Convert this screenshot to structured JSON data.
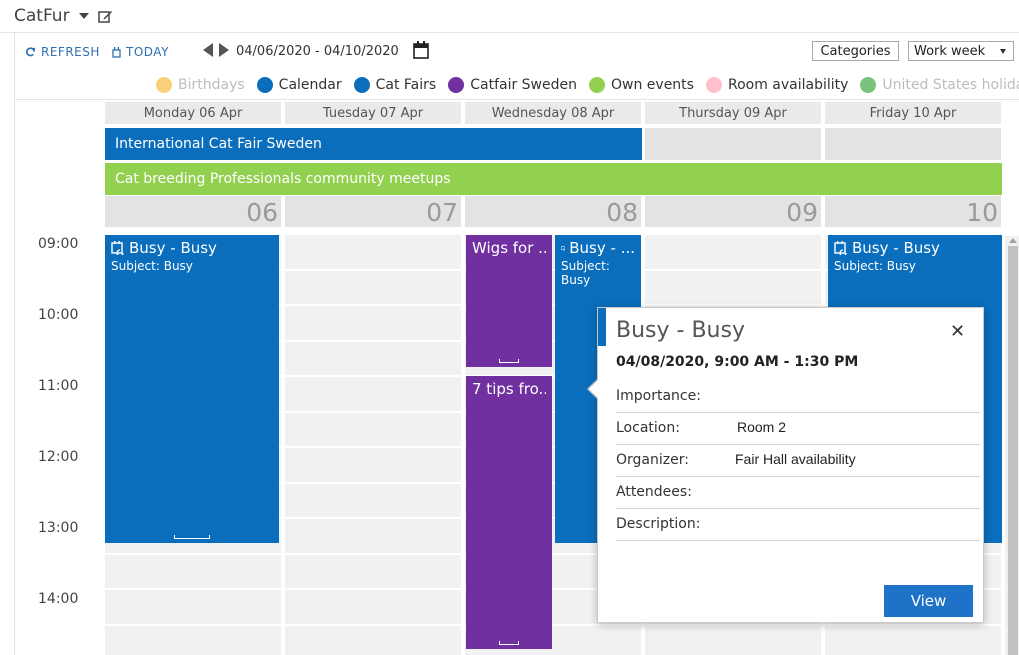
{
  "app": {
    "title": "CatFur"
  },
  "toolbar": {
    "refresh_label": "REFRESH",
    "today_label": "TODAY",
    "date_range": "04/06/2020 - 04/10/2020",
    "categories_label": "Categories",
    "view_select_value": "Work week"
  },
  "legend": [
    {
      "label": "Birthdays",
      "color": "#f5c04a",
      "dimmed": true
    },
    {
      "label": "Calendar",
      "color": "#0a6ebd",
      "dimmed": false
    },
    {
      "label": "Cat Fairs",
      "color": "#0a6ebd",
      "dimmed": false
    },
    {
      "label": "Catfair Sweden",
      "color": "#7030a0",
      "dimmed": false
    },
    {
      "label": "Own events",
      "color": "#92d050",
      "dimmed": false
    },
    {
      "label": "Room availability",
      "color": "#ffc0cb",
      "dimmed": false
    },
    {
      "label": "United States holidays",
      "color": "#4caf50",
      "dimmed": true
    }
  ],
  "days": [
    {
      "header": "Monday 06 Apr",
      "number": "06"
    },
    {
      "header": "Tuesday 07 Apr",
      "number": "07"
    },
    {
      "header": "Wednesday 08 Apr",
      "number": "08"
    },
    {
      "header": "Thursday 09 Apr",
      "number": "09"
    },
    {
      "header": "Friday 10 Apr",
      "number": "10"
    }
  ],
  "allday_events": [
    {
      "title": "International Cat Fair Sweden",
      "color": "#0a6ebd"
    },
    {
      "title": "Cat breeding Professionals community meetups",
      "color": "#92d050"
    }
  ],
  "times": [
    "09:00",
    "10:00",
    "11:00",
    "12:00",
    "13:00",
    "14:00"
  ],
  "events": {
    "mon_busy": {
      "title": "Busy - Busy",
      "subject": "Subject: Busy",
      "color": "#0a6ebd"
    },
    "wed_wigs": {
      "title": "Wigs for ...",
      "color": "#7030a0"
    },
    "wed_tips": {
      "title": "7 tips fro...",
      "color": "#7030a0"
    },
    "wed_busy": {
      "title": "Busy - ...",
      "subject": "Subject: Busy",
      "color": "#0a6ebd"
    },
    "fri_busy": {
      "title": "Busy - Busy",
      "subject": "Subject: Busy",
      "color": "#0a6ebd"
    }
  },
  "popup": {
    "title": "Busy - Busy",
    "datetime": "04/08/2020, 9:00 AM - 1:30 PM",
    "accent_color": "#0a6ebd",
    "fields": [
      {
        "label": "Importance:",
        "value": ""
      },
      {
        "label": "Location:",
        "value": "Room 2"
      },
      {
        "label": "Organizer:",
        "value": "Fair Hall availability"
      },
      {
        "label": "Attendees:",
        "value": ""
      },
      {
        "label": "Description:",
        "value": ""
      }
    ],
    "view_label": "View",
    "close_icon": "close-icon"
  }
}
